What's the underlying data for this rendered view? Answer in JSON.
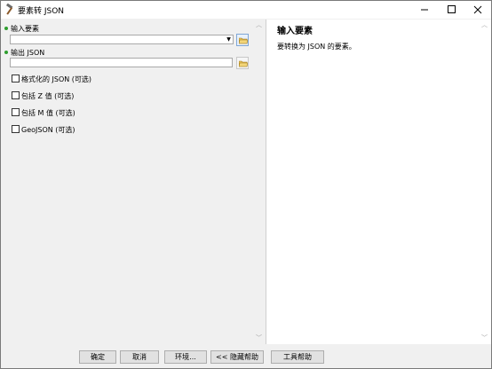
{
  "window": {
    "title": "要素转 JSON"
  },
  "params": {
    "input_label": "输入要素",
    "input_value": "",
    "output_label": "输出 JSON",
    "output_value": "",
    "checkboxes": [
      {
        "label": "格式化的 JSON (可选)",
        "checked": false
      },
      {
        "label": "包括 Z 值 (可选)",
        "checked": false
      },
      {
        "label": "包括 M 值 (可选)",
        "checked": false
      },
      {
        "label": "GeoJSON (可选)",
        "checked": false
      }
    ]
  },
  "help": {
    "title": "输入要素",
    "text": "要转换为 JSON 的要素。"
  },
  "buttons": {
    "ok": "确定",
    "cancel": "取消",
    "env": "环境...",
    "hide_help": "<< 隐藏帮助",
    "tool_help": "工具帮助"
  }
}
